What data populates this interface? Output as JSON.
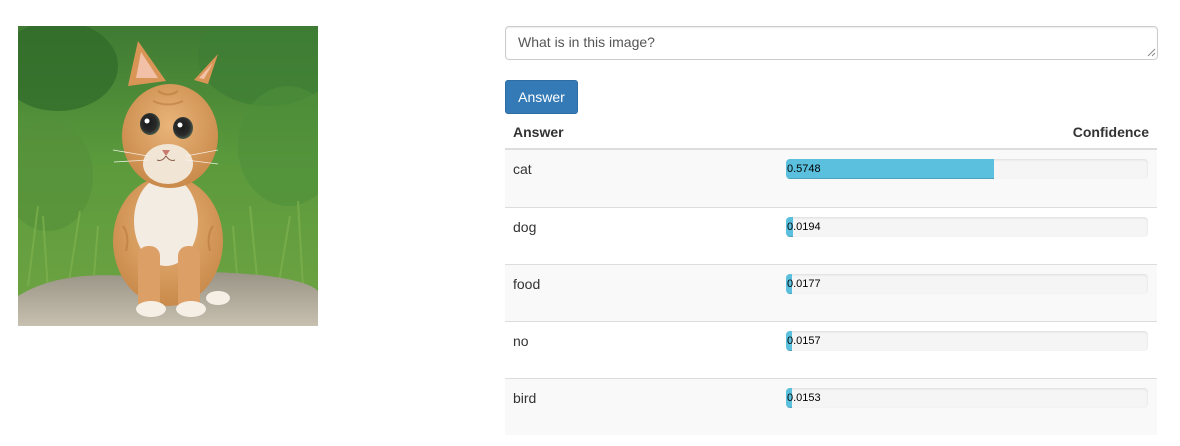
{
  "question": {
    "value": "What is in this image?"
  },
  "answer_button": {
    "label": "Answer",
    "color": "#337ab7"
  },
  "results": {
    "header_answer": "Answer",
    "header_confidence": "Confidence",
    "bar_color": "#5bc0de",
    "rows": [
      {
        "label": "cat",
        "confidence_text": "0.5748",
        "confidence": 0.5748
      },
      {
        "label": "dog",
        "confidence_text": "0.0194",
        "confidence": 0.0194
      },
      {
        "label": "food",
        "confidence_text": "0.0177",
        "confidence": 0.0177
      },
      {
        "label": "no",
        "confidence_text": "0.0157",
        "confidence": 0.0157
      },
      {
        "label": "bird",
        "confidence_text": "0.0153",
        "confidence": 0.0153
      }
    ]
  }
}
